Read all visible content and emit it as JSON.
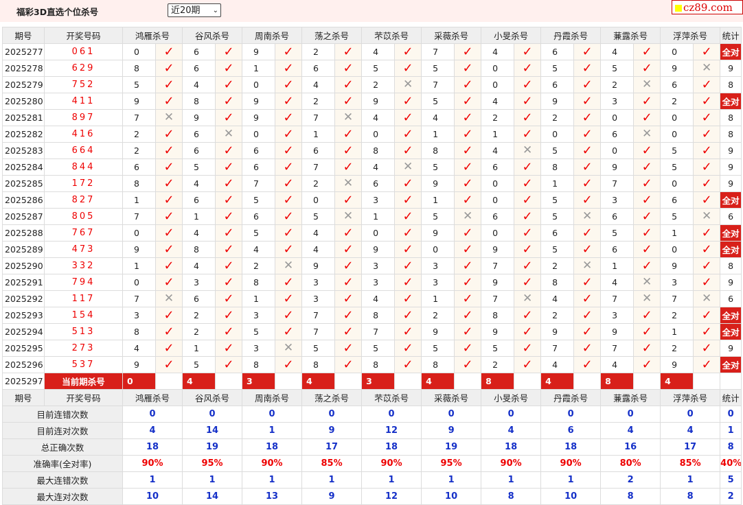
{
  "header": {
    "title": "福彩3D直选个位杀号",
    "period_select": "近20期",
    "site_logo": "cz89.com"
  },
  "columns": {
    "issue": "期号",
    "draw": "开奖号码",
    "experts": [
      "鸿雁杀号",
      "谷风杀号",
      "周南杀号",
      "荡之杀号",
      "芣苡杀号",
      "采薇杀号",
      "小旻杀号",
      "丹霞杀号",
      "蒹露杀号",
      "浮萍杀号"
    ],
    "stat": "统计"
  },
  "marks": {
    "ok": "✓",
    "no": "✕"
  },
  "rows": [
    {
      "issue": "2025277",
      "draw": "061",
      "picks": [
        [
          0,
          1
        ],
        [
          6,
          1
        ],
        [
          9,
          1
        ],
        [
          2,
          1
        ],
        [
          4,
          1
        ],
        [
          7,
          1
        ],
        [
          4,
          1
        ],
        [
          6,
          1
        ],
        [
          4,
          1
        ],
        [
          0,
          1
        ]
      ],
      "stat": "全对"
    },
    {
      "issue": "2025278",
      "draw": "629",
      "picks": [
        [
          8,
          1
        ],
        [
          6,
          1
        ],
        [
          1,
          1
        ],
        [
          6,
          1
        ],
        [
          5,
          1
        ],
        [
          5,
          1
        ],
        [
          0,
          1
        ],
        [
          5,
          1
        ],
        [
          5,
          1
        ],
        [
          9,
          0
        ]
      ],
      "stat": "9"
    },
    {
      "issue": "2025279",
      "draw": "752",
      "picks": [
        [
          5,
          1
        ],
        [
          4,
          1
        ],
        [
          0,
          1
        ],
        [
          4,
          1
        ],
        [
          2,
          0
        ],
        [
          7,
          1
        ],
        [
          0,
          1
        ],
        [
          6,
          1
        ],
        [
          2,
          0
        ],
        [
          6,
          1
        ]
      ],
      "stat": "8"
    },
    {
      "issue": "2025280",
      "draw": "411",
      "picks": [
        [
          9,
          1
        ],
        [
          8,
          1
        ],
        [
          9,
          1
        ],
        [
          2,
          1
        ],
        [
          9,
          1
        ],
        [
          5,
          1
        ],
        [
          4,
          1
        ],
        [
          9,
          1
        ],
        [
          3,
          1
        ],
        [
          2,
          1
        ]
      ],
      "stat": "全对"
    },
    {
      "issue": "2025281",
      "draw": "897",
      "picks": [
        [
          7,
          0
        ],
        [
          9,
          1
        ],
        [
          9,
          1
        ],
        [
          7,
          0
        ],
        [
          4,
          1
        ],
        [
          4,
          1
        ],
        [
          2,
          1
        ],
        [
          2,
          1
        ],
        [
          0,
          1
        ],
        [
          0,
          1
        ]
      ],
      "stat": "8"
    },
    {
      "issue": "2025282",
      "draw": "416",
      "picks": [
        [
          2,
          1
        ],
        [
          6,
          0
        ],
        [
          0,
          1
        ],
        [
          1,
          1
        ],
        [
          0,
          1
        ],
        [
          1,
          1
        ],
        [
          1,
          1
        ],
        [
          0,
          1
        ],
        [
          6,
          0
        ],
        [
          0,
          1
        ]
      ],
      "stat": "8"
    },
    {
      "issue": "2025283",
      "draw": "664",
      "picks": [
        [
          2,
          1
        ],
        [
          6,
          1
        ],
        [
          6,
          1
        ],
        [
          6,
          1
        ],
        [
          8,
          1
        ],
        [
          8,
          1
        ],
        [
          4,
          0
        ],
        [
          5,
          1
        ],
        [
          0,
          1
        ],
        [
          5,
          1
        ]
      ],
      "stat": "9"
    },
    {
      "issue": "2025284",
      "draw": "844",
      "picks": [
        [
          6,
          1
        ],
        [
          5,
          1
        ],
        [
          6,
          1
        ],
        [
          7,
          1
        ],
        [
          4,
          0
        ],
        [
          5,
          1
        ],
        [
          6,
          1
        ],
        [
          8,
          1
        ],
        [
          9,
          1
        ],
        [
          5,
          1
        ]
      ],
      "stat": "9"
    },
    {
      "issue": "2025285",
      "draw": "172",
      "picks": [
        [
          8,
          1
        ],
        [
          4,
          1
        ],
        [
          7,
          1
        ],
        [
          2,
          0
        ],
        [
          6,
          1
        ],
        [
          9,
          1
        ],
        [
          0,
          1
        ],
        [
          1,
          1
        ],
        [
          7,
          1
        ],
        [
          0,
          1
        ]
      ],
      "stat": "9"
    },
    {
      "issue": "2025286",
      "draw": "827",
      "picks": [
        [
          1,
          1
        ],
        [
          6,
          1
        ],
        [
          5,
          1
        ],
        [
          0,
          1
        ],
        [
          3,
          1
        ],
        [
          1,
          1
        ],
        [
          0,
          1
        ],
        [
          5,
          1
        ],
        [
          3,
          1
        ],
        [
          6,
          1
        ]
      ],
      "stat": "全对"
    },
    {
      "issue": "2025287",
      "draw": "805",
      "picks": [
        [
          7,
          1
        ],
        [
          1,
          1
        ],
        [
          6,
          1
        ],
        [
          5,
          0
        ],
        [
          1,
          1
        ],
        [
          5,
          0
        ],
        [
          6,
          1
        ],
        [
          5,
          0
        ],
        [
          6,
          1
        ],
        [
          5,
          0
        ]
      ],
      "stat": "6"
    },
    {
      "issue": "2025288",
      "draw": "767",
      "picks": [
        [
          0,
          1
        ],
        [
          4,
          1
        ],
        [
          5,
          1
        ],
        [
          4,
          1
        ],
        [
          0,
          1
        ],
        [
          9,
          1
        ],
        [
          0,
          1
        ],
        [
          6,
          1
        ],
        [
          5,
          1
        ],
        [
          1,
          1
        ]
      ],
      "stat": "全对"
    },
    {
      "issue": "2025289",
      "draw": "473",
      "picks": [
        [
          9,
          1
        ],
        [
          8,
          1
        ],
        [
          4,
          1
        ],
        [
          4,
          1
        ],
        [
          9,
          1
        ],
        [
          0,
          1
        ],
        [
          9,
          1
        ],
        [
          5,
          1
        ],
        [
          6,
          1
        ],
        [
          0,
          1
        ]
      ],
      "stat": "全对"
    },
    {
      "issue": "2025290",
      "draw": "332",
      "picks": [
        [
          1,
          1
        ],
        [
          4,
          1
        ],
        [
          2,
          0
        ],
        [
          9,
          1
        ],
        [
          3,
          1
        ],
        [
          3,
          1
        ],
        [
          7,
          1
        ],
        [
          2,
          0
        ],
        [
          1,
          1
        ],
        [
          9,
          1
        ]
      ],
      "stat": "8"
    },
    {
      "issue": "2025291",
      "draw": "794",
      "picks": [
        [
          0,
          1
        ],
        [
          3,
          1
        ],
        [
          8,
          1
        ],
        [
          3,
          1
        ],
        [
          3,
          1
        ],
        [
          3,
          1
        ],
        [
          9,
          1
        ],
        [
          8,
          1
        ],
        [
          4,
          0
        ],
        [
          3,
          1
        ]
      ],
      "stat": "9"
    },
    {
      "issue": "2025292",
      "draw": "117",
      "picks": [
        [
          7,
          0
        ],
        [
          6,
          1
        ],
        [
          1,
          1
        ],
        [
          3,
          1
        ],
        [
          4,
          1
        ],
        [
          1,
          1
        ],
        [
          7,
          0
        ],
        [
          4,
          1
        ],
        [
          7,
          0
        ],
        [
          7,
          0
        ]
      ],
      "stat": "6"
    },
    {
      "issue": "2025293",
      "draw": "154",
      "picks": [
        [
          3,
          1
        ],
        [
          2,
          1
        ],
        [
          3,
          1
        ],
        [
          7,
          1
        ],
        [
          8,
          1
        ],
        [
          2,
          1
        ],
        [
          8,
          1
        ],
        [
          2,
          1
        ],
        [
          3,
          1
        ],
        [
          2,
          1
        ]
      ],
      "stat": "全对"
    },
    {
      "issue": "2025294",
      "draw": "513",
      "picks": [
        [
          8,
          1
        ],
        [
          2,
          1
        ],
        [
          5,
          1
        ],
        [
          7,
          1
        ],
        [
          7,
          1
        ],
        [
          9,
          1
        ],
        [
          9,
          1
        ],
        [
          9,
          1
        ],
        [
          9,
          1
        ],
        [
          1,
          1
        ]
      ],
      "stat": "全对"
    },
    {
      "issue": "2025295",
      "draw": "273",
      "picks": [
        [
          4,
          1
        ],
        [
          1,
          1
        ],
        [
          3,
          0
        ],
        [
          5,
          1
        ],
        [
          5,
          1
        ],
        [
          5,
          1
        ],
        [
          5,
          1
        ],
        [
          7,
          1
        ],
        [
          7,
          1
        ],
        [
          2,
          1
        ]
      ],
      "stat": "9"
    },
    {
      "issue": "2025296",
      "draw": "537",
      "picks": [
        [
          9,
          1
        ],
        [
          5,
          1
        ],
        [
          8,
          1
        ],
        [
          8,
          1
        ],
        [
          8,
          1
        ],
        [
          8,
          1
        ],
        [
          2,
          1
        ],
        [
          4,
          1
        ],
        [
          4,
          1
        ],
        [
          9,
          1
        ]
      ],
      "stat": "全对"
    }
  ],
  "current": {
    "issue": "2025297",
    "label": "当前期杀号",
    "picks": [
      "0",
      "4",
      "3",
      "4",
      "3",
      "4",
      "8",
      "4",
      "8",
      "4"
    ]
  },
  "stats": [
    {
      "label": "目前连错次数",
      "values": [
        "0",
        "0",
        "0",
        "0",
        "0",
        "0",
        "0",
        "0",
        "0",
        "0",
        "0"
      ]
    },
    {
      "label": "目前连对次数",
      "values": [
        "4",
        "14",
        "1",
        "9",
        "12",
        "9",
        "4",
        "6",
        "4",
        "4",
        "1"
      ]
    },
    {
      "label": "总正确次数",
      "values": [
        "18",
        "19",
        "18",
        "17",
        "18",
        "19",
        "18",
        "18",
        "16",
        "17",
        "8"
      ]
    },
    {
      "label": "准确率(全对率)",
      "values": [
        "90%",
        "95%",
        "90%",
        "85%",
        "90%",
        "95%",
        "90%",
        "90%",
        "80%",
        "85%",
        "40%"
      ],
      "red": true
    },
    {
      "label": "最大连错次数",
      "values": [
        "1",
        "1",
        "1",
        "1",
        "1",
        "1",
        "1",
        "1",
        "2",
        "1",
        "5"
      ]
    },
    {
      "label": "最大连对次数",
      "values": [
        "10",
        "14",
        "13",
        "9",
        "12",
        "10",
        "8",
        "10",
        "8",
        "8",
        "2"
      ]
    }
  ]
}
